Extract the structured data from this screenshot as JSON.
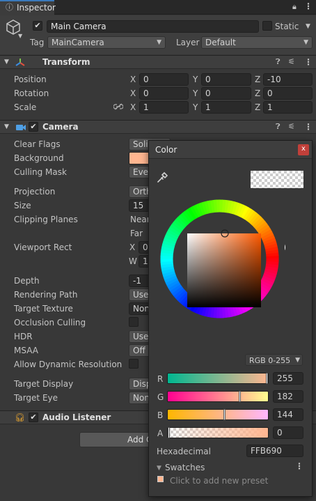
{
  "tab": {
    "icon": "info-icon",
    "title": "Inspector"
  },
  "window_icons": {
    "lock": "lock-icon",
    "menu": "kebab-icon"
  },
  "gameobject": {
    "name": "Main Camera",
    "static_label": "Static",
    "tag_label": "Tag",
    "tag_value": "MainCamera",
    "layer_label": "Layer",
    "layer_value": "Default"
  },
  "transform": {
    "title": "Transform",
    "position_label": "Position",
    "rotation_label": "Rotation",
    "scale_label": "Scale",
    "x": "X",
    "y": "Y",
    "z": "Z",
    "position": [
      "0",
      "0",
      "-10"
    ],
    "rotation": [
      "0",
      "0",
      "0"
    ],
    "scale": [
      "1",
      "1",
      "1"
    ]
  },
  "camera": {
    "title": "Camera",
    "labels": {
      "clear_flags": "Clear Flags",
      "background": "Background",
      "culling_mask": "Culling Mask",
      "projection": "Projection",
      "size": "Size",
      "clipping_planes": "Clipping Planes",
      "viewport_rect": "Viewport Rect",
      "depth": "Depth",
      "rendering_path": "Rendering Path",
      "target_texture": "Target Texture",
      "occlusion_culling": "Occlusion Culling",
      "hdr": "HDR",
      "msaa": "MSAA",
      "allow_dynamic_resolution": "Allow Dynamic Resolution",
      "target_display": "Target Display",
      "target_eye": "Target Eye"
    },
    "values": {
      "clear_flags": "Solid",
      "culling_mask": "Ever",
      "projection": "Orth",
      "size": "15",
      "near": "Near",
      "far": "Far",
      "viewport_x_label": "X",
      "viewport_x": "0",
      "viewport_w_label": "W",
      "viewport_w": "1",
      "depth": "-1",
      "rendering_path": "Use",
      "target_texture": "None",
      "hdr": "Use",
      "msaa": "Off",
      "target_display": "Disp",
      "target_eye": "None"
    },
    "background_color": "#FFB690"
  },
  "audio_listener": {
    "title": "Audio Listener"
  },
  "add_component": "Add C",
  "color_picker": {
    "title": "Color",
    "close": "x",
    "mode": "RGB 0-255",
    "channels": [
      {
        "label": "R",
        "value": "255"
      },
      {
        "label": "G",
        "value": "182"
      },
      {
        "label": "B",
        "value": "144"
      },
      {
        "label": "A",
        "value": "0"
      }
    ],
    "hex_label": "Hexadecimal",
    "hex_value": "FFB690",
    "swatches_label": "Swatches",
    "add_preset": "Click to add new preset"
  }
}
